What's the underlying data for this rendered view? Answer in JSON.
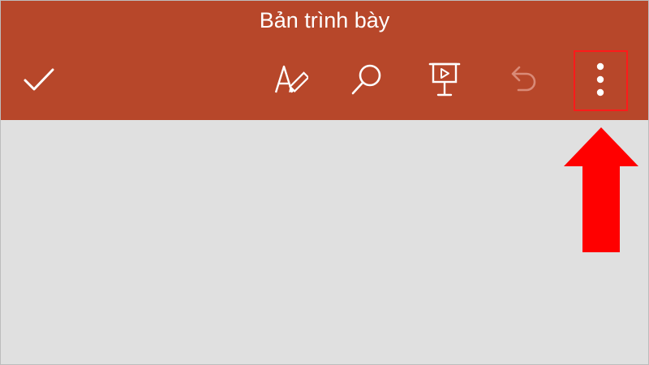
{
  "app": {
    "title": "Bản trình bày"
  },
  "toolbar": {
    "buttons": [
      {
        "name": "done",
        "icon": "check-icon"
      },
      {
        "name": "ink-draw",
        "icon": "pen-text-icon"
      },
      {
        "name": "find",
        "icon": "search-icon"
      },
      {
        "name": "present",
        "icon": "slideshow-icon"
      },
      {
        "name": "undo",
        "icon": "undo-icon",
        "state": "disabled"
      },
      {
        "name": "more-options",
        "icon": "more-vert-icon"
      }
    ]
  },
  "annotation": {
    "highlight_target": "more-options",
    "color": "#ff0000"
  },
  "colors": {
    "appbar": "#b7472a",
    "canvas": "#e0e0e0",
    "icon": "#ffffff",
    "icon_disabled": "#d98a77"
  }
}
